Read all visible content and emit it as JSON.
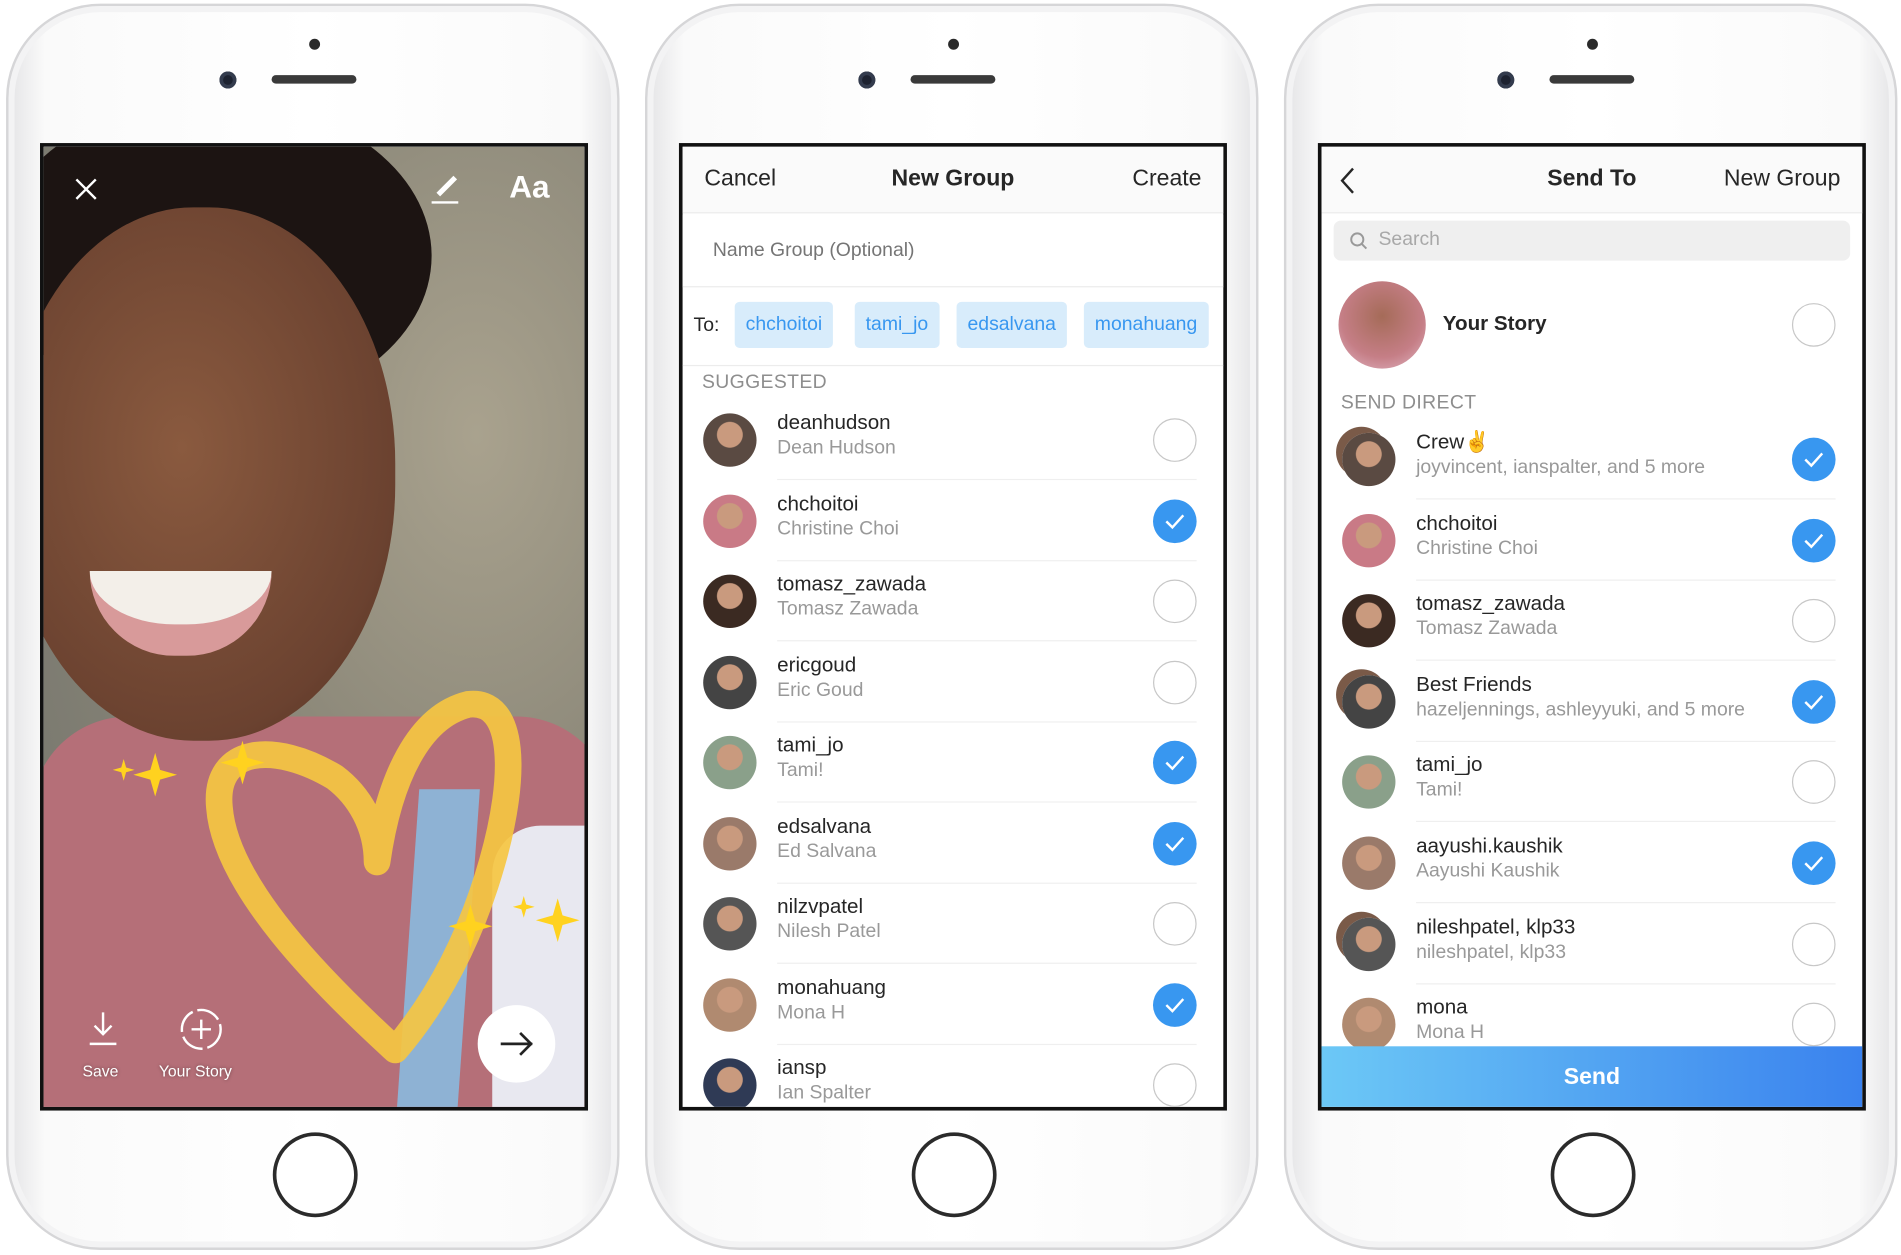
{
  "screen_camera": {
    "close_icon": "x",
    "pen_icon": "pencil",
    "text_tool": "Aa",
    "save_label": "Save",
    "your_story_label": "Your Story",
    "next_icon": "arrow-right",
    "heart_color": "#f5c542"
  },
  "screen_new_group": {
    "cancel": "Cancel",
    "title": "New Group",
    "create": "Create",
    "name_placeholder": "Name Group (Optional)",
    "to_label": "To:",
    "chips": [
      "chchoitoi",
      "tami_jo",
      "edsalvana",
      "monahuang"
    ],
    "section": "SUGGESTED",
    "rows": [
      {
        "username": "deanhudson",
        "name": "Dean Hudson",
        "checked": false
      },
      {
        "username": "chchoitoi",
        "name": "Christine Choi",
        "checked": true
      },
      {
        "username": "tomasz_zawada",
        "name": "Tomasz Zawada",
        "checked": false
      },
      {
        "username": "ericgoud",
        "name": "Eric Goud",
        "checked": false
      },
      {
        "username": "tami_jo",
        "name": "Tami!",
        "checked": true
      },
      {
        "username": "edsalvana",
        "name": "Ed Salvana",
        "checked": true
      },
      {
        "username": "nilzvpatel",
        "name": "Nilesh Patel",
        "checked": false
      },
      {
        "username": "monahuang",
        "name": "Mona H",
        "checked": true
      },
      {
        "username": "iansp",
        "name": "Ian Spalter",
        "checked": false
      }
    ]
  },
  "screen_send_to": {
    "back_icon": "chevron-left",
    "title": "Send To",
    "new_group": "New Group",
    "search_placeholder": "Search",
    "your_story": {
      "label": "Your Story",
      "checked": false
    },
    "section": "SEND DIRECT",
    "rows": [
      {
        "username": "Crew✌",
        "name": "joyvincent, ianspalter, and 5 more",
        "checked": true,
        "group": true
      },
      {
        "username": "chchoitoi",
        "name": "Christine Choi",
        "checked": true
      },
      {
        "username": "tomasz_zawada",
        "name": "Tomasz Zawada",
        "checked": false
      },
      {
        "username": "Best Friends",
        "name": "hazeljennings, ashleyyuki, and 5 more",
        "checked": true,
        "group": true
      },
      {
        "username": "tami_jo",
        "name": "Tami!",
        "checked": false
      },
      {
        "username": "aayushi.kaushik",
        "name": "Aayushi Kaushik",
        "checked": true
      },
      {
        "username": "nileshpatel, klp33",
        "name": "nileshpatel, klp33",
        "checked": false,
        "group": true
      },
      {
        "username": "mona",
        "name": "Mona H",
        "checked": false
      }
    ],
    "send": "Send"
  },
  "colors": {
    "accent": "#3897f0",
    "chip_bg": "#d8ecfb",
    "send_gradient": [
      "#6cc8f6",
      "#3a82ee"
    ]
  }
}
